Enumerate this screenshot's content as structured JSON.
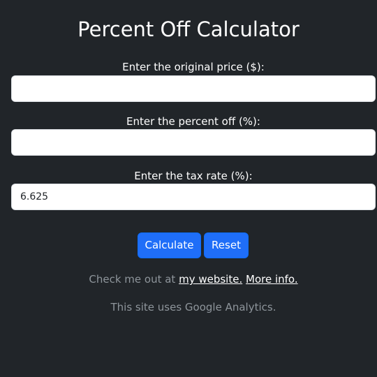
{
  "header": {
    "title": "Percent Off Calculator"
  },
  "form": {
    "original_price": {
      "label": "Enter the original price ($):",
      "value": ""
    },
    "percent_off": {
      "label": "Enter the percent off (%):",
      "value": ""
    },
    "tax_rate": {
      "label": "Enter the tax rate (%):",
      "value": "6.625"
    }
  },
  "buttons": {
    "calculate_label": "Calculate",
    "reset_label": "Reset"
  },
  "footer": {
    "check_prefix": "Check me out at",
    "website_link": "my website.",
    "more_info_link": "More info.",
    "analytics_note": "This site uses Google Analytics."
  },
  "colors": {
    "background": "#212529",
    "button": "#1f6ef8",
    "muted_text": "#8e959b"
  }
}
